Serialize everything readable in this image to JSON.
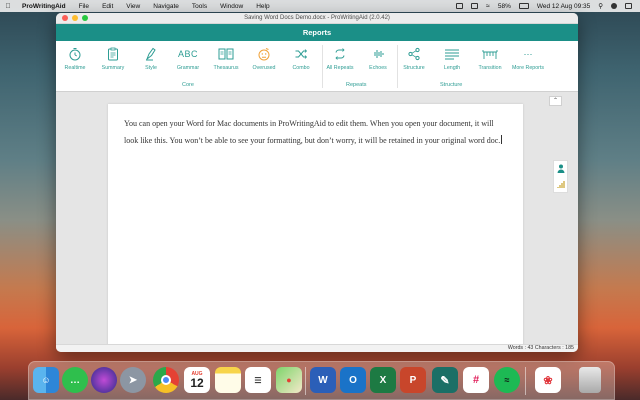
{
  "menubar": {
    "app_name": "ProWritingAid",
    "items": [
      "File",
      "Edit",
      "View",
      "Navigate",
      "Tools",
      "Window",
      "Help"
    ],
    "battery": "58%",
    "datetime": "Wed 12 Aug  09:35"
  },
  "window": {
    "title": "Saving Word Docs Demo.docx - ProWritingAid (2.0.42)",
    "reports_header": "Reports"
  },
  "ribbon": {
    "tools": [
      {
        "label": "Realtime",
        "icon": "clock-icon"
      },
      {
        "label": "Summary",
        "icon": "clipboard-icon"
      },
      {
        "label": "Style",
        "icon": "pen-icon"
      },
      {
        "label": "Grammar",
        "icon": "abc-icon"
      },
      {
        "label": "Thesaurus",
        "icon": "book-icon"
      },
      {
        "label": "Overused",
        "icon": "face-icon"
      },
      {
        "label": "Combo",
        "icon": "shuffle-icon"
      },
      {
        "label": "All Repeats",
        "icon": "repeat-icon"
      },
      {
        "label": "Echoes",
        "icon": "waveform-icon"
      },
      {
        "label": "Structure",
        "icon": "share-icon"
      },
      {
        "label": "Length",
        "icon": "lines-icon"
      },
      {
        "label": "Transition",
        "icon": "bridge-icon"
      },
      {
        "label": "More Reports",
        "icon": "more-icon"
      }
    ],
    "groups": [
      "Core",
      "Repeats",
      "Structure"
    ]
  },
  "document": {
    "text": "You can open your Word for Mac documents in ProWritingAid to edit them. When you open your document, it will look like this. You won’t be able to see your formatting, but don’t worry, it will be retained in your original word doc."
  },
  "statusbar": {
    "text": "Words : 43 Characters : 185"
  },
  "dock": {
    "calendar_month": "AUG",
    "calendar_day": "12",
    "apps": [
      "Finder",
      "Messages",
      "Siri",
      "Launchpad",
      "Chrome",
      "Calendar",
      "Notes",
      "Reminders",
      "Maps",
      "Word",
      "Outlook",
      "Excel",
      "PowerPoint",
      "ProWritingAid",
      "Slack",
      "Spotify",
      "Creative Cloud",
      "Trash"
    ]
  },
  "colors": {
    "accent": "#1b8f87",
    "accent_text": "#2e9d94"
  }
}
